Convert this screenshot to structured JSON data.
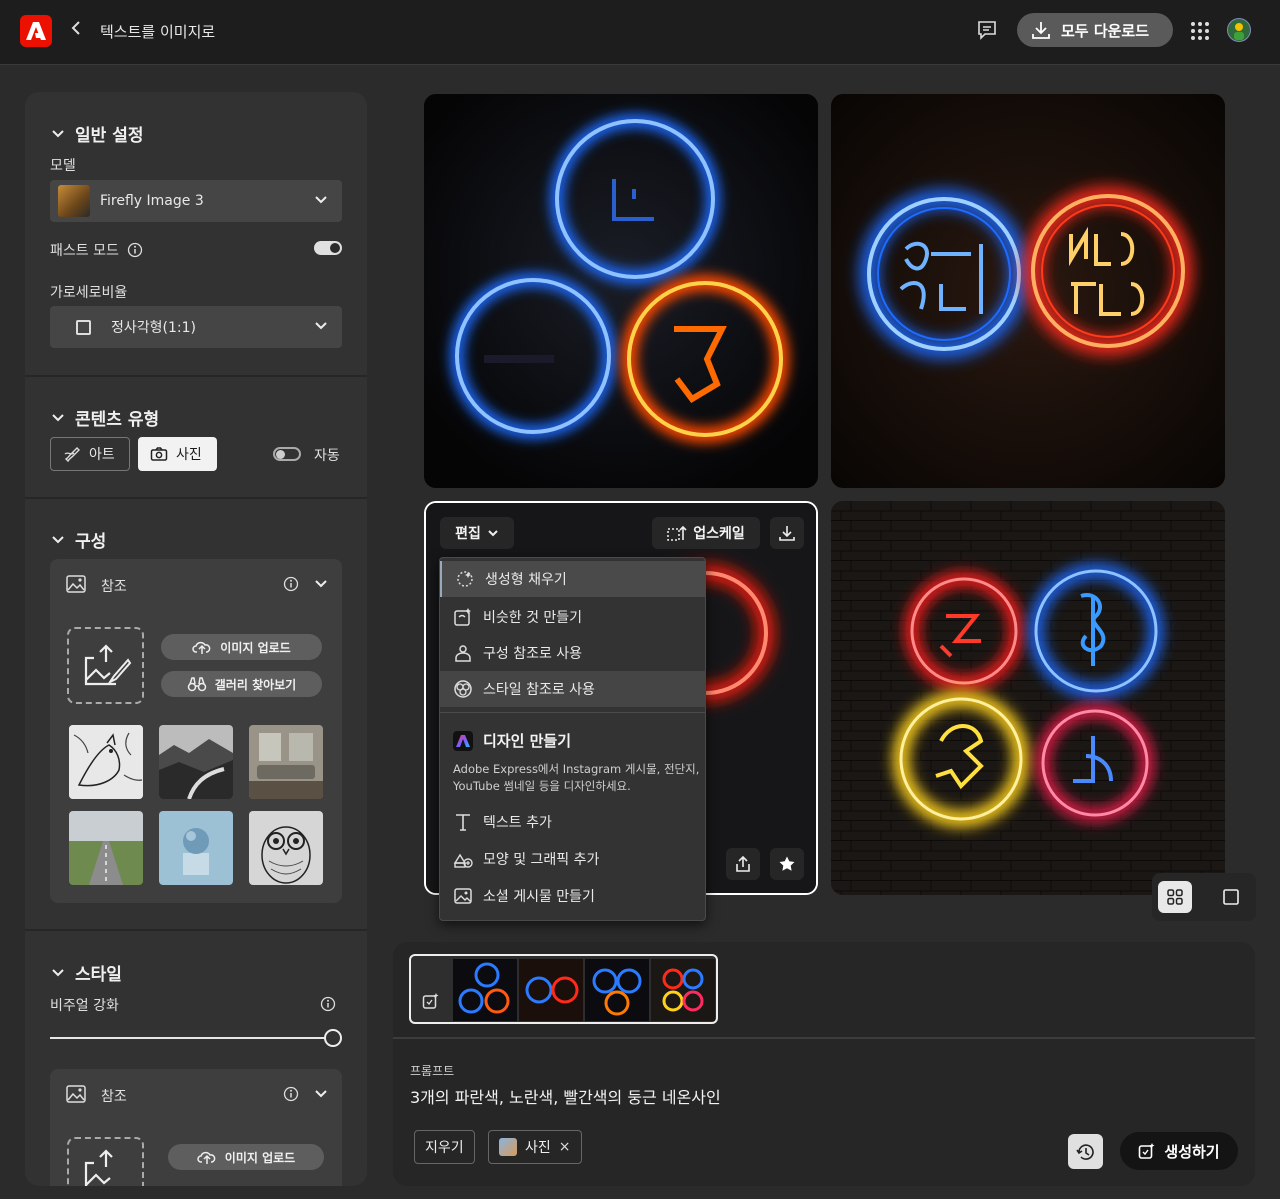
{
  "topbar": {
    "title": "텍스트를 이미지로",
    "download_all": "모두 다운로드"
  },
  "general": {
    "title": "일반 설정",
    "model_label": "모델",
    "model_value": "Firefly Image 3",
    "fast_mode_label": "패스트 모드",
    "fast_mode_on": true,
    "aspect_label": "가로세로비율",
    "aspect_value": "정사각형(1:1)"
  },
  "content_type": {
    "title": "콘텐츠 유형",
    "art_label": "아트",
    "photo_label": "사진",
    "selected": "사진",
    "auto_label": "자동",
    "auto_on": false
  },
  "composition": {
    "title": "구성",
    "reference_label": "참조",
    "upload_label": "이미지 업로드",
    "gallery_label": "갤러리 찾아보기"
  },
  "style": {
    "title": "스타일",
    "visual_boost_label": "비주얼 강화",
    "visual_boost_level": 1.0,
    "reference_label": "참조",
    "upload_label": "이미지 업로드"
  },
  "image_toolbar": {
    "edit_label": "편집",
    "upscale_label": "업스케일"
  },
  "edit_menu": {
    "items": [
      "생성형 채우기",
      "비슷한 것 만들기",
      "구성 참조로 사용",
      "스타일 참조로 사용"
    ],
    "design_title": "디자인 만들기",
    "design_desc_line1": "Adobe Express에서 Instagram 게시물, 전단지,",
    "design_desc_line2": "YouTube 썸네일 등을 디자인하세요.",
    "design_items": [
      "텍스트 추가",
      "모양 및 그래픽 추가",
      "소셜 게시물 만들기"
    ]
  },
  "prompt": {
    "label": "프롬프트",
    "text": "3개의 파란색, 노란색, 빨간색의 둥근 네온사인",
    "clear_label": "지우기",
    "tag_label": "사진",
    "tag_remove": "×",
    "generate_label": "생성하기"
  },
  "colors": {
    "accent": "#eb1000",
    "neon_blue": "#1e6bff",
    "neon_red": "#ff2a1a",
    "neon_yellow": "#ffd21a",
    "neon_orange": "#ff7a00"
  }
}
